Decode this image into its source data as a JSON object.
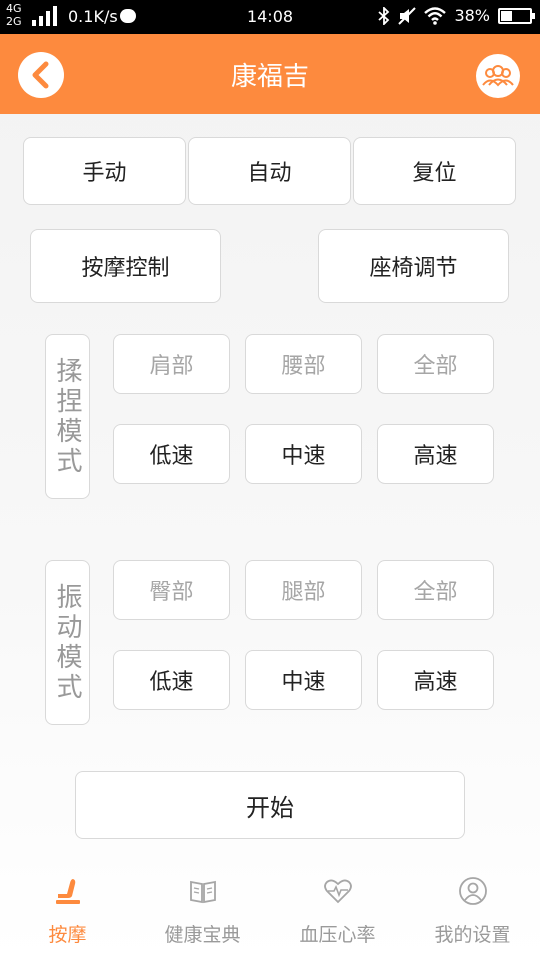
{
  "status_bar": {
    "network": [
      "4G",
      "2G"
    ],
    "speed": "0.1K/s",
    "time": "14:08",
    "battery": "38%",
    "battery_level": 0.38
  },
  "header": {
    "title": "康福吉",
    "back_icon": "chevron-left-icon",
    "users_icon": "users-icon",
    "accent_color": "#fd8a3e"
  },
  "mode_buttons": [
    "手动",
    "自动",
    "复位"
  ],
  "control_buttons": [
    "按摩控制",
    "座椅调节"
  ],
  "kneading": {
    "label": "揉捏模式",
    "areas": [
      "肩部",
      "腰部",
      "全部"
    ],
    "speeds": [
      "低速",
      "中速",
      "高速"
    ]
  },
  "vibration": {
    "label": "振动模式",
    "areas": [
      "臀部",
      "腿部",
      "全部"
    ],
    "speeds": [
      "低速",
      "中速",
      "高速"
    ]
  },
  "start_button": "开始",
  "tabs": [
    {
      "label": "按摩",
      "icon": "seat-icon",
      "active": true
    },
    {
      "label": "健康宝典",
      "icon": "book-icon",
      "active": false
    },
    {
      "label": "血压心率",
      "icon": "heart-rate-icon",
      "active": false
    },
    {
      "label": "我的设置",
      "icon": "user-icon",
      "active": false
    }
  ]
}
